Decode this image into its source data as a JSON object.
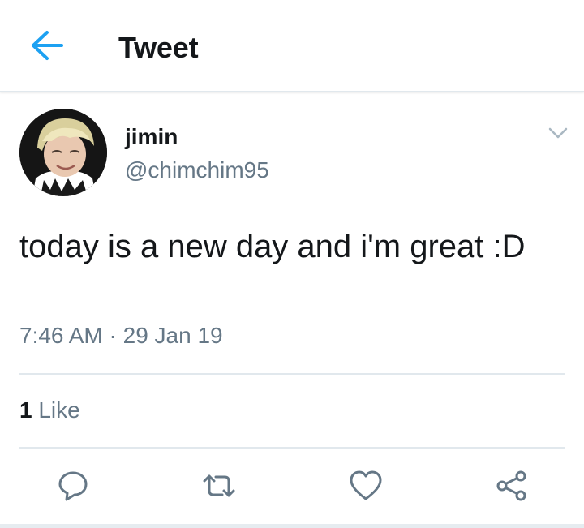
{
  "header": {
    "title": "Tweet",
    "back_icon": "back-arrow-icon",
    "accent_color": "#1da1f2"
  },
  "tweet": {
    "author_name": "jimin",
    "author_handle": "@chimchim95",
    "text": "today is a new day and i'm great :D",
    "time": "7:46 AM",
    "separator": "·",
    "date": "29 Jan 19",
    "like_count": "1",
    "like_label": "Like",
    "menu_icon": "chevron-down-icon"
  },
  "actions": [
    {
      "name": "reply",
      "icon": "reply-icon"
    },
    {
      "name": "retweet",
      "icon": "retweet-icon"
    },
    {
      "name": "like",
      "icon": "heart-icon"
    },
    {
      "name": "share",
      "icon": "share-icon"
    }
  ]
}
